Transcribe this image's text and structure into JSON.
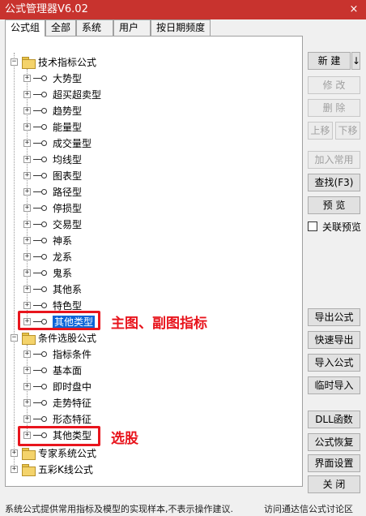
{
  "window": {
    "title": "公式管理器V6.02",
    "close_label": "×"
  },
  "tabs": [
    {
      "label": "公式组",
      "active": true
    },
    {
      "label": "全部",
      "active": false
    },
    {
      "label": "系统",
      "active": false
    },
    {
      "label": "用户",
      "active": false
    },
    {
      "label": "按日期频度",
      "active": false
    }
  ],
  "tree": {
    "tech": {
      "label": "技术指标公式",
      "children": [
        "大势型",
        "超买超卖型",
        "趋势型",
        "能量型",
        "成交量型",
        "均线型",
        "图表型",
        "路径型",
        "停损型",
        "交易型",
        "神系",
        "龙系",
        "鬼系",
        "其他系",
        "特色型",
        "其他类型"
      ]
    },
    "stock": {
      "label": "条件选股公式",
      "children": [
        "指标条件",
        "基本面",
        "即时盘中",
        "走势特征",
        "形态特征",
        "其他类型"
      ]
    },
    "expert": {
      "label": "专家系统公式"
    },
    "kline": {
      "label": "五彩K线公式"
    },
    "expand_sign": "+",
    "collapse_sign": "−"
  },
  "annotations": {
    "main_chart": "主图、副图指标",
    "stock_pick": "选股"
  },
  "buttons": {
    "new": "新 建",
    "new_arrow": "↓",
    "modify": "修 改",
    "delete": "删 除",
    "move_up": "上移",
    "move_down": "下移",
    "add_common": "加入常用",
    "find": "查找(F3)",
    "preview": "预 览",
    "link_preview": "关联预览",
    "export": "导出公式",
    "quick_export": "快速导出",
    "import": "导入公式",
    "temp_import": "临时导入",
    "dll": "DLL函数",
    "restore": "公式恢复",
    "ui_settings": "界面设置",
    "close": "关 闭"
  },
  "status": {
    "text": "系统公式提供常用指标及模型的实现样本,不表示操作建议.",
    "link": "访问通达信公式讨论区"
  }
}
